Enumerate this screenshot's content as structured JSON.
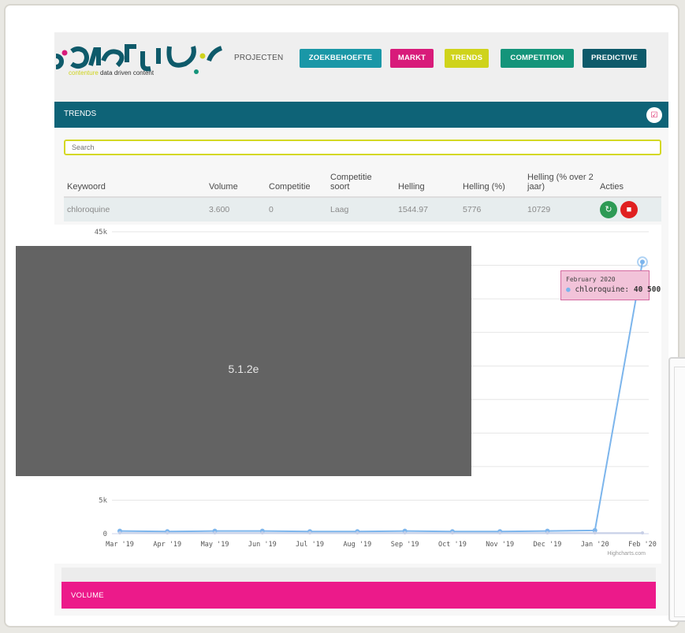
{
  "nav": {
    "logo_text": "contentur",
    "logo_tagline_brand": "contenture",
    "logo_tagline_rest": " data driven content",
    "items": [
      {
        "label": "PROJECTEN",
        "style": "plain"
      },
      {
        "label": "ZOEKBEHOEFTE",
        "color": "#1a97a7"
      },
      {
        "label": "MARKT",
        "color": "#d81b7a"
      },
      {
        "label": "TRENDS",
        "color": "#cfd31b"
      },
      {
        "label": "COMPETITION",
        "color": "#14947a"
      },
      {
        "label": "PREDICTIVE",
        "color": "#0e5a6a"
      }
    ]
  },
  "trends": {
    "title": "TRENDS",
    "icon": "checkbox-icon"
  },
  "search": {
    "placeholder": "Search"
  },
  "table": {
    "headers": [
      "Keywoord",
      "Volume",
      "Competitie",
      "Competitie soort",
      "Helling",
      "Helling (%)",
      "Helling (% over 2 jaar)",
      "Acties"
    ],
    "rows": [
      {
        "keyword": "chloroquine",
        "volume": "3.600",
        "competitie": "0",
        "soort": "Laag",
        "helling": "1544.97",
        "helling_pct": "5776",
        "helling_2j": "10729"
      }
    ]
  },
  "chart_data": {
    "type": "line",
    "categories": [
      "Mar '19",
      "Apr '19",
      "May '19",
      "Jun '19",
      "Jul '19",
      "Aug '19",
      "Sep '19",
      "Oct '19",
      "Nov '19",
      "Dec '19",
      "Jan '20",
      "Feb '20"
    ],
    "series": [
      {
        "name": "chloroquine",
        "color": "#7cb5ec",
        "values": [
          390,
          320,
          390,
          390,
          320,
          320,
          390,
          320,
          320,
          390,
          480,
          40500
        ]
      },
      {
        "name": "",
        "color": "#c7cfe6",
        "values": [
          120,
          120,
          120,
          120,
          120,
          120,
          120,
          120,
          120,
          120,
          120,
          120
        ]
      }
    ],
    "ylim": [
      0,
      45000
    ],
    "y_ticks_visible": [
      "45k",
      "5k",
      "0"
    ],
    "credit": "Highcharts.com",
    "tooltip": {
      "date": "February 2020",
      "series": "chloroquine",
      "value": "40 500"
    }
  },
  "redaction": {
    "label": "5.1.2e"
  },
  "volume": {
    "title": "VOLUME"
  }
}
